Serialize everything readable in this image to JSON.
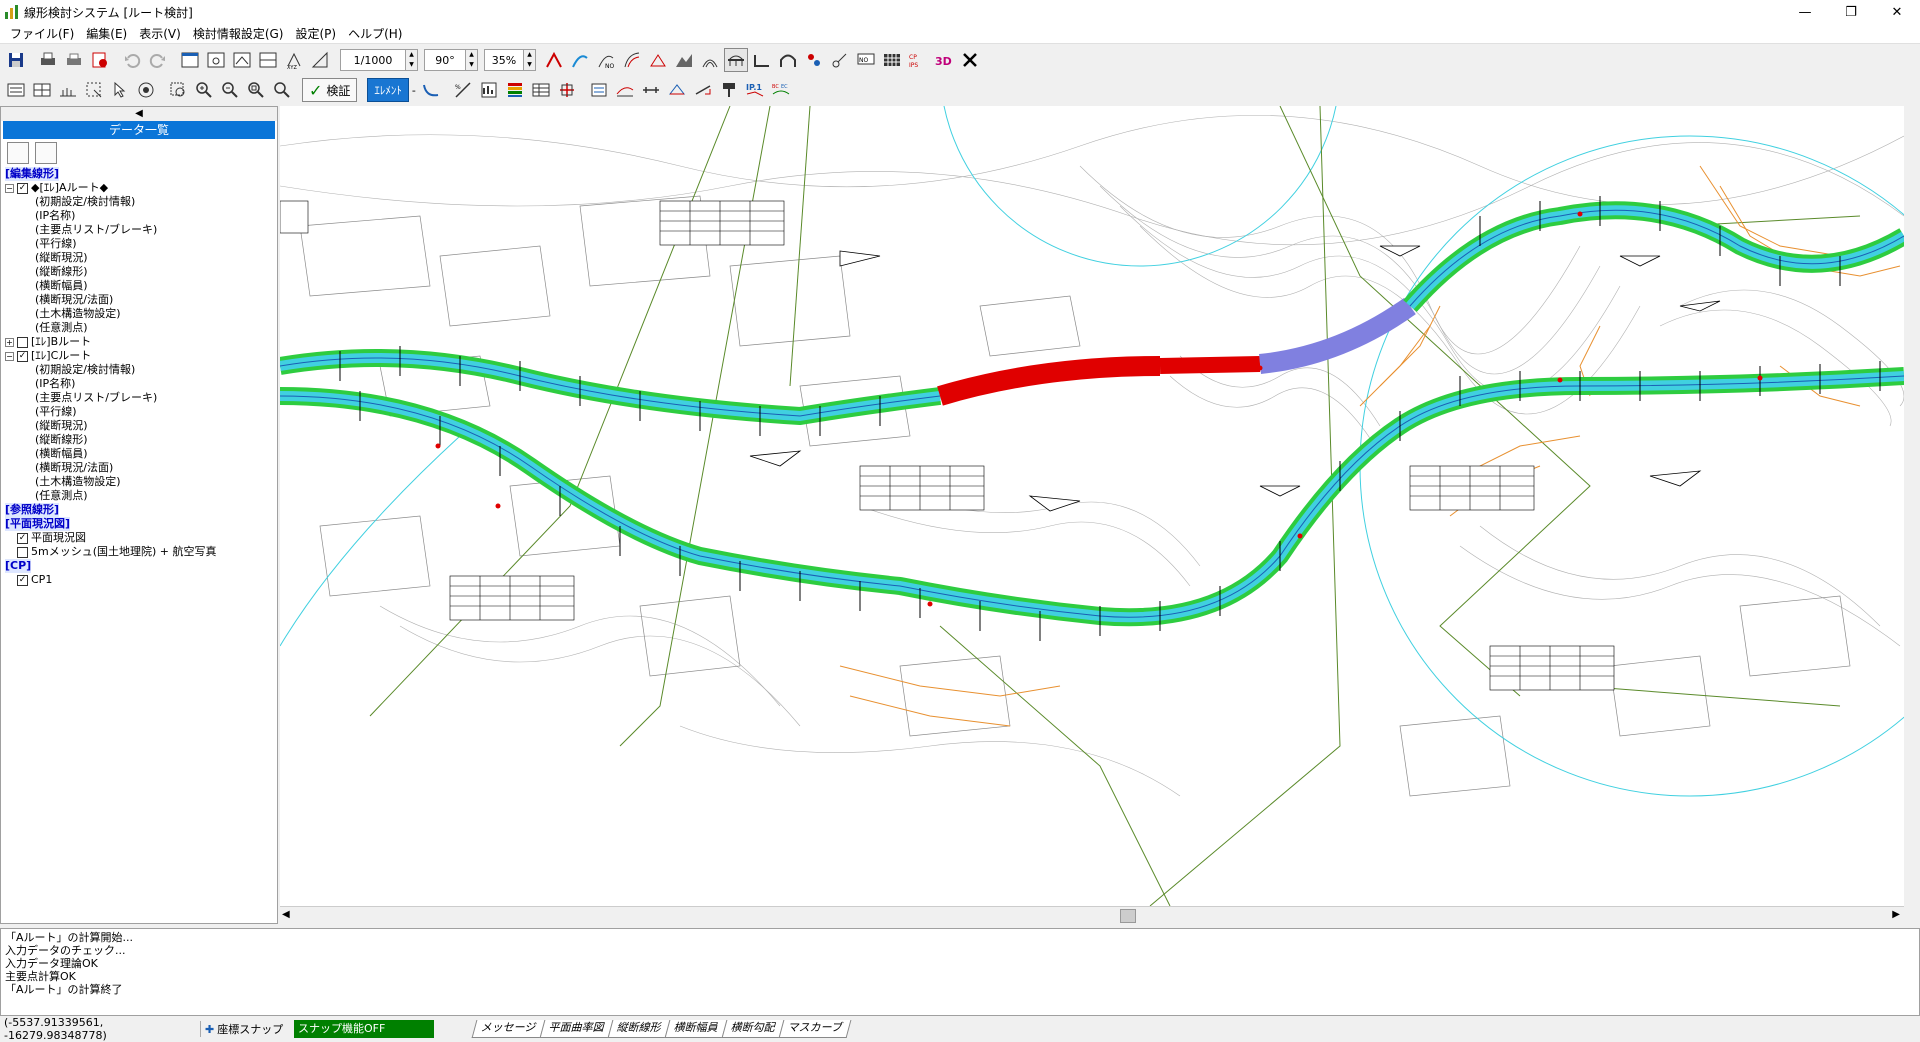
{
  "window": {
    "title": "線形検討システム [ルート検討]",
    "controls": [
      "—",
      "❐",
      "✕"
    ]
  },
  "menu": [
    "ファイル(F)",
    "編集(E)",
    "表示(V)",
    "検討情報設定(G)",
    "設定(P)",
    "ヘルプ(H)"
  ],
  "toolbar1": {
    "scale": "1/1000",
    "angle": "90°",
    "percent": "35%"
  },
  "toolbar2": {
    "verify_label": "検証",
    "element_label": "ｴﾚﾒﾝﾄ",
    "element_dash": "-"
  },
  "sidepanel": {
    "header": "データ一覧",
    "sections": {
      "edit_alignment": "[編集線形]",
      "reference_alignment": "[参照線形]",
      "plan_status": "[平面現況図]",
      "cp": "[CP]"
    },
    "route_a": "◆[ｴﾚ]Aルート◆",
    "route_a_items": [
      "(初期設定/検討情報)",
      "(IP名称)",
      "(主要点リスト/ブレーキ)",
      "(平行線)",
      "(縦断現況)",
      "(縦断線形)",
      "(横断幅員)",
      "(横断現況/法面)",
      "(土木構造物設定)",
      "(任意測点)"
    ],
    "route_b": "[ｴﾚ]Bルート",
    "route_c": "[ｴﾚ]Cルート",
    "route_c_items": [
      "(初期設定/検討情報)",
      "(IP名称)",
      "(主要点リスト/ブレーキ)",
      "(平行線)",
      "(縦断現況)",
      "(縦断線形)",
      "(横断幅員)",
      "(横断現況/法面)",
      "(土木構造物設定)",
      "(任意測点)"
    ],
    "plan_items": [
      "平面現況図",
      "5mメッシュ(国土地理院) + 航空写真"
    ],
    "cp_items": [
      "CP1"
    ]
  },
  "log": [
    "「Aルート」の計算開始...",
    "入力データのチェック...",
    "入力データ理論OK",
    "主要点計算OK",
    "「Aルート」の計算終了"
  ],
  "status": {
    "coords": "(-5537.91339561, -16279.98348778)",
    "snap_label": "座標スナップ",
    "snap_state": "スナップ機能OFF",
    "tabs": [
      "メッセージ",
      "平面曲率図",
      "縦断線形",
      "横断幅員",
      "横断勾配",
      "マスカーブ"
    ]
  },
  "colors": {
    "accent": "#0a75d8",
    "road_green": "#2ecc40",
    "road_cyan": "#40d0e0",
    "cut_red": "#e00000",
    "fill_blue": "#8080e0",
    "slope_orange": "#e89030",
    "snap_off_bg": "#008000"
  }
}
